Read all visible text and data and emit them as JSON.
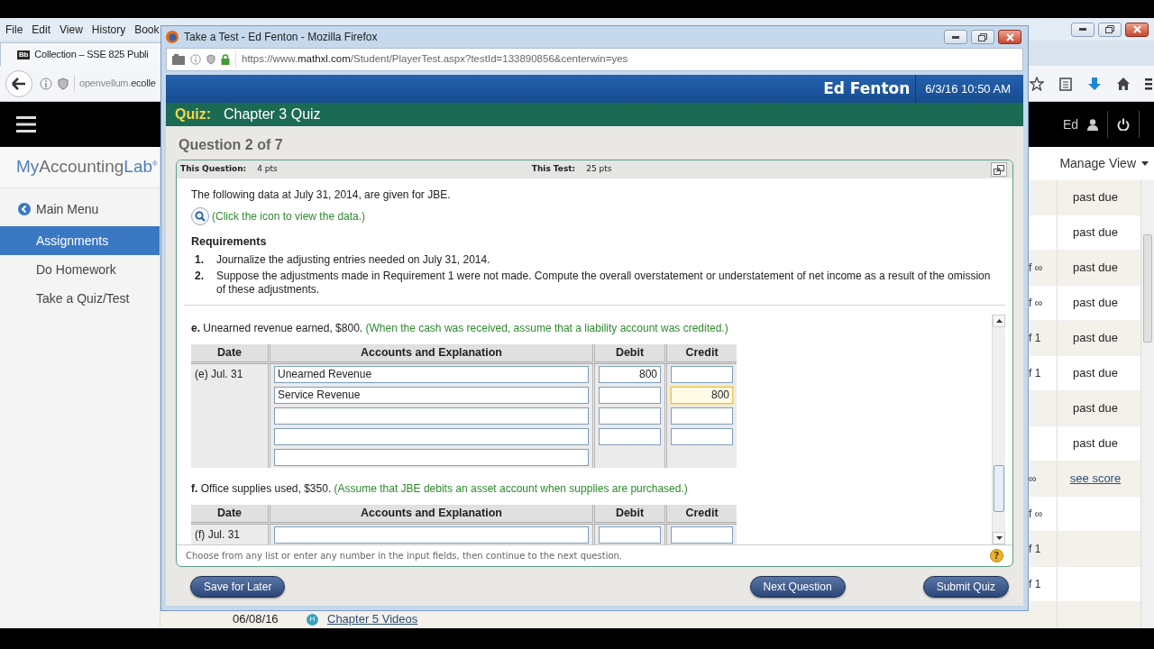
{
  "background": {
    "menu": [
      "File",
      "Edit",
      "View",
      "History",
      "Book"
    ],
    "tab": {
      "icon": "Bb",
      "title": "Collection – SSE 825 Publi"
    },
    "address": {
      "dim": "openvellum.",
      "strong": "ecolle"
    },
    "user": "Ed",
    "logo": {
      "parts": [
        {
          "text": "My",
          "accent": true
        },
        {
          "text": "Accounting",
          "accent": false
        },
        {
          "text": "Lab",
          "accent": true
        }
      ],
      "mark": "®"
    },
    "sidebar": [
      {
        "kind": "back",
        "label": "Main Menu",
        "selected": false
      },
      {
        "kind": "link",
        "label": "Assignments",
        "selected": true
      },
      {
        "kind": "link",
        "label": "Do Homework",
        "selected": false
      },
      {
        "kind": "link",
        "label": "Take a Quiz/Test",
        "selected": false
      }
    ],
    "manage_view": "Manage View",
    "rows": [
      {
        "status": "past due",
        "kind": "text"
      },
      {
        "status": "past due",
        "kind": "text"
      },
      {
        "column_1": "f ∞",
        "status": "past due",
        "kind": "text"
      },
      {
        "column_1": "f ∞",
        "status": "past due",
        "kind": "text"
      },
      {
        "column_1": "f 1",
        "status": "past due",
        "kind": "text"
      },
      {
        "column_1": "f 1",
        "status": "past due",
        "kind": "text"
      },
      {
        "status": "past due",
        "kind": "text"
      },
      {
        "status": "past due",
        "kind": "text"
      },
      {
        "column_1": "∞",
        "status": "see score",
        "kind": "link"
      },
      {
        "column_1": "f ∞"
      },
      {
        "column_1": "f 1"
      },
      {
        "column_1": "f 1"
      }
    ],
    "bottom_row": {
      "date": "06/08/16",
      "badge": "H",
      "title": "Chapter 5 Videos"
    }
  },
  "popup": {
    "title": "Take a Test - Ed Fenton - Mozilla Firefox",
    "url": {
      "scheme": "https://www.",
      "host": "mathxl.com",
      "path": "/Student/PlayerTest.aspx?testId=133890856&centerwin=yes"
    },
    "user": "Ed Fenton",
    "datetime": "6/3/16 10:50 AM",
    "quiz_label": "Quiz:",
    "quiz_title": "Chapter 3 Quiz",
    "question_counter": "Question 2 of 7",
    "score_info": [
      {
        "label": "This Question:",
        "value": "4 pts"
      },
      {
        "label": "This Test:",
        "value": "25 pts"
      }
    ],
    "intro": "The following data at July 31, 2014, are given for JBE.",
    "data_link": "(Click the icon to view the data.)",
    "requirements": {
      "title": "Requirements",
      "items": [
        {
          "number": "1.",
          "text": "Journalize the adjusting entries needed on July 31, 2014."
        },
        {
          "number": "2.",
          "text": "Suppose the adjustments made in Requirement 1 were not made. Compute the overall overstatement or understatement of net income as a result of the omission of these adjustments."
        }
      ]
    },
    "parts": [
      {
        "text": "**e.** Unearned revenue earned, $800.",
        "hint": "(When the cash was received, assume that a liability account was credited.)",
        "columns": [
          "Date",
          "Accounts and Explanation",
          "Debit",
          "Credit"
        ],
        "date": "(e) Jul. 31",
        "rows": [
          {
            "kind": "entry",
            "account": "Unearned Revenue",
            "debit": "800",
            "credit_focused": false
          },
          {
            "kind": "entry",
            "account": "Service Revenue",
            "credit": "800",
            "credit_focused": true
          },
          {
            "kind": "entry",
            "credit_focused": false
          },
          {
            "kind": "entry",
            "credit_focused": false
          },
          {
            "kind": "account_only"
          }
        ]
      },
      {
        "text": "**f.** Office supplies used, $350.",
        "hint": "(Assume that JBE debits an asset account when supplies are purchased.)",
        "columns": [
          "Date",
          "Accounts and Explanation",
          "Debit",
          "Credit"
        ],
        "date": "(f) Jul. 31",
        "rows": [
          {
            "kind": "entry",
            "credit_focused": false
          }
        ]
      }
    ],
    "footer_hint": "Choose from any list or enter any number in the input fields, then continue to the next question.",
    "help": "?",
    "buttons": [
      "Save for Later",
      "Next Question",
      "Submit Quiz"
    ]
  }
}
